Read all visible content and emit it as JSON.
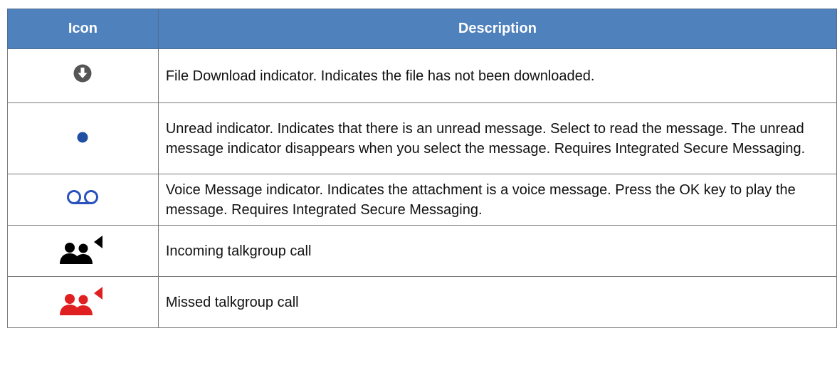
{
  "table": {
    "headers": {
      "icon": "Icon",
      "description": "Description"
    },
    "rows": [
      {
        "icon": "download-icon",
        "description": "File Download indicator. Indicates the file has not been downloaded."
      },
      {
        "icon": "unread-dot-icon",
        "description": "Unread indicator. Indicates that there is an unread message. Select to read the message. The unread message indicator disappears when you select the message. Requires Integrated Secure Messaging."
      },
      {
        "icon": "voicemail-icon",
        "description": "Voice Message indicator. Indicates the attachment is a voice message. Press the OK key to play the message. Requires Integrated Secure Messaging."
      },
      {
        "icon": "incoming-talkgroup-icon",
        "description": "Incoming talkgroup call"
      },
      {
        "icon": "missed-talkgroup-icon",
        "description": "Missed talkgroup call"
      }
    ]
  },
  "colors": {
    "header_bg": "#4f81bd",
    "header_text": "#ffffff",
    "download_icon": "#555555",
    "unread_dot": "#1f4ea3",
    "voicemail": "#2a52be",
    "incoming": "#000000",
    "missed": "#e02020"
  }
}
